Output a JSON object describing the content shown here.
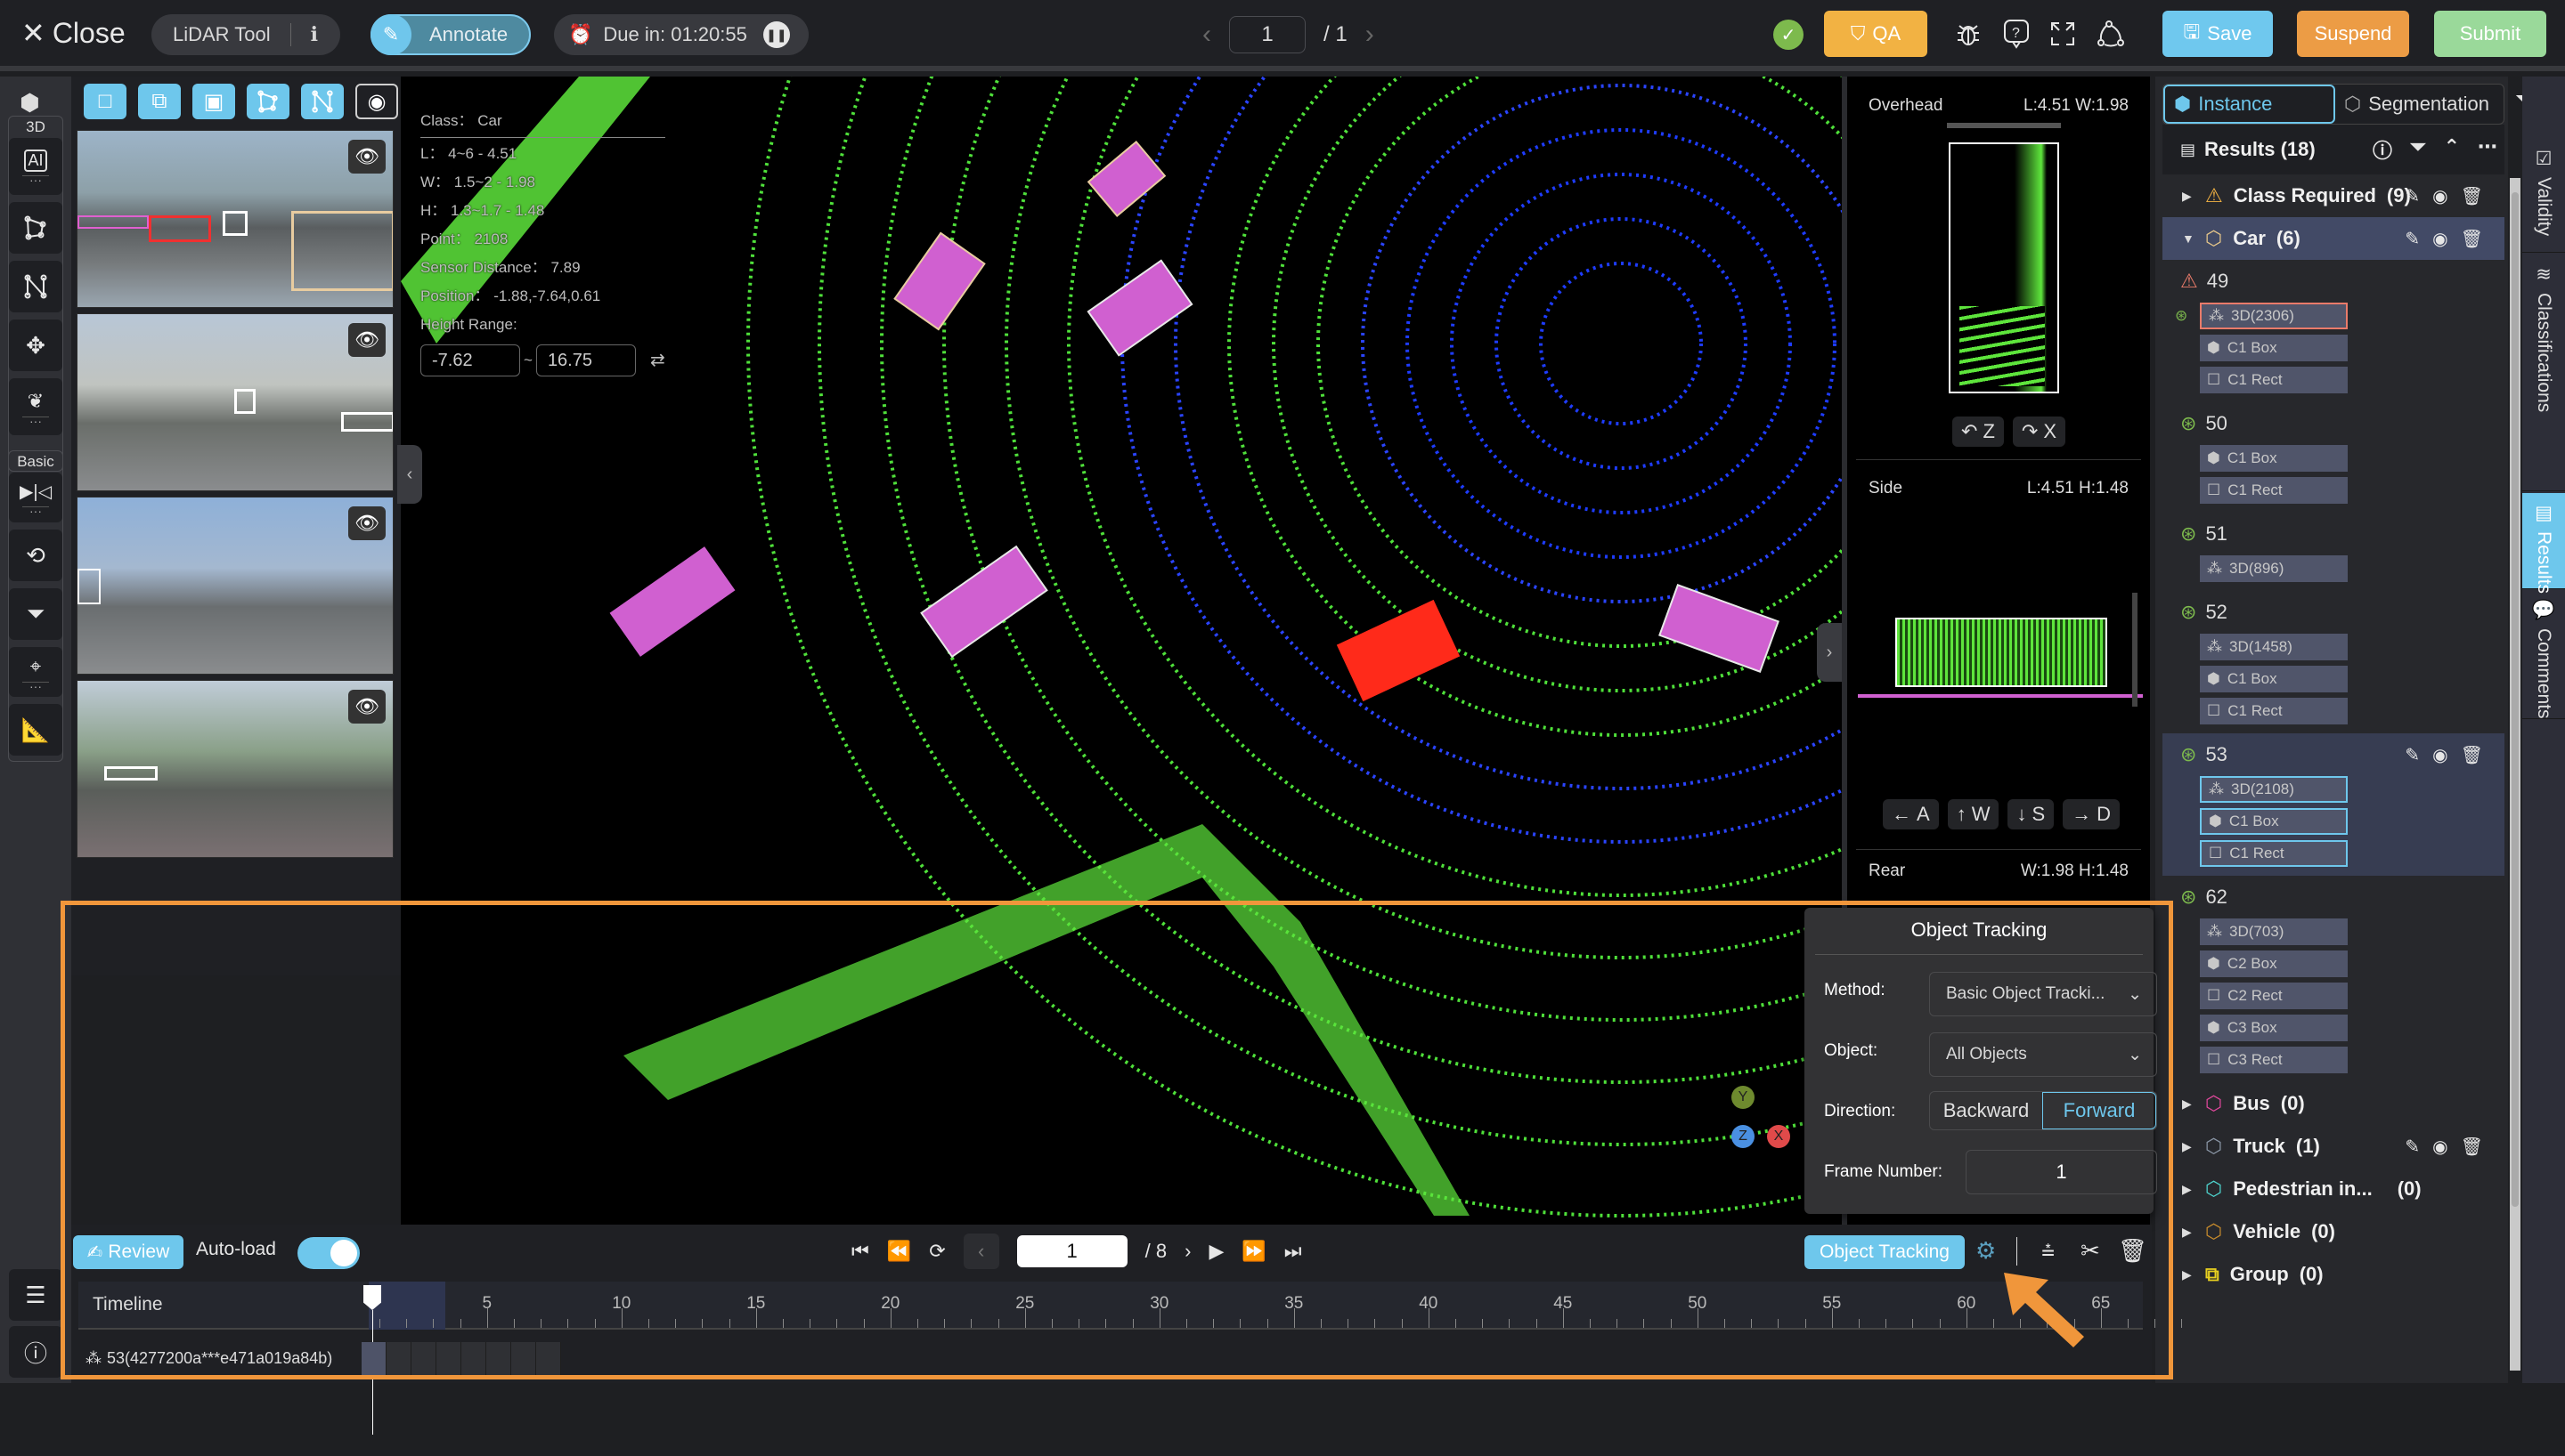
{
  "header": {
    "close_label": "Close",
    "tool_name": "LiDAR Tool",
    "mode_label": "Annotate",
    "due_label": "Due in: 01:20:55",
    "page_current": "1",
    "page_total": "/ 1",
    "qa_label": "QA",
    "save_label": "Save",
    "suspend_label": "Suspend",
    "submit_label": "Submit",
    "icons": [
      "bug-icon",
      "help-icon",
      "fullscreen-icon",
      "workflow-icon"
    ]
  },
  "left_rail": {
    "group_3d_label": "3D",
    "group_basic_label": "Basic"
  },
  "info_overlay": {
    "class_line": "Class：  Car",
    "l_line": "L：  4~6 - 4.51",
    "w_line": "W：  1.5~2 - 1.98",
    "h_line": "H：  1.3~1.7 - 1.48",
    "point_line": "Point：  2108",
    "sensor_line": "Sensor Distance：  7.89",
    "position_line": "Position：  -1.88,-7.64,0.61",
    "height_range_label": "Height Range:",
    "height_min": "-7.62",
    "height_max": "16.75"
  },
  "projections": {
    "overhead": {
      "label": "Overhead",
      "dims": "L:4.51 W:1.98"
    },
    "side": {
      "label": "Side",
      "dims": "L:4.51 H:1.48"
    },
    "rear": {
      "label": "Rear",
      "dims": "W:1.98 H:1.48"
    },
    "rotate_z": "Z",
    "rotate_x": "X",
    "move_keys": [
      "A",
      "W",
      "S",
      "D"
    ]
  },
  "axes": {
    "y": "Y",
    "z": "Z",
    "x": "X"
  },
  "right_panel": {
    "tab_instance": "Instance",
    "tab_segmentation": "Segmentation",
    "results_title": "Results (18)",
    "classes": [
      {
        "name": "Class Required",
        "count": "(9)",
        "color": "#f2b243",
        "expanded": false
      },
      {
        "name": "Car",
        "count": "(6)",
        "color": "#e8c88a",
        "expanded": true
      },
      {
        "name": "Bus",
        "count": "(0)",
        "color": "#e0489c"
      },
      {
        "name": "Truck",
        "count": "(1)",
        "color": "#8a96a6"
      },
      {
        "name": "Pedestrian in...",
        "count": "(0)",
        "color": "#4ed6d0"
      },
      {
        "name": "Vehicle",
        "count": "(0)",
        "color": "#c88c2c"
      },
      {
        "name": "Group",
        "count": "(0)",
        "color": "#e8d020"
      }
    ],
    "instances": [
      {
        "id": "49",
        "chips": [
          "3D(2306)",
          "C1 Box",
          "C1 Rect"
        ]
      },
      {
        "id": "50",
        "chips": [
          "C1 Box",
          "C1 Rect"
        ]
      },
      {
        "id": "51",
        "chips": [
          "3D(896)"
        ]
      },
      {
        "id": "52",
        "chips": [
          "3D(1458)",
          "C1 Box",
          "C1 Rect"
        ]
      },
      {
        "id": "53",
        "chips": [
          "3D(2108)",
          "C1 Box",
          "C1 Rect"
        ]
      },
      {
        "id": "62",
        "chips": [
          "3D(703)",
          "C2 Box",
          "C2 Rect",
          "C3 Box",
          "C3 Rect"
        ]
      }
    ]
  },
  "vertical_tabs": [
    "Validity",
    "Classifications",
    "Results",
    "Comments"
  ],
  "bottom": {
    "review_label": "Review",
    "autoload_label": "Auto-load",
    "autoload_on": true,
    "frame_current": "1",
    "frame_total": "/ 8",
    "object_tracking_label": "Object Tracking",
    "timeline_label": "Timeline",
    "tick_labels": [
      "5",
      "10",
      "15",
      "20",
      "25",
      "30",
      "35",
      "40",
      "45",
      "50",
      "55",
      "60",
      "65"
    ],
    "track_label": "53(4277200a***e471a019a84b)"
  },
  "tracking_popup": {
    "title": "Object Tracking",
    "method_label": "Method:",
    "method_value": "Basic Object Tracki...",
    "object_label": "Object:",
    "object_value": "All Objects",
    "direction_label": "Direction:",
    "direction_options": [
      "Backward",
      "Forward"
    ],
    "direction_selected": "Forward",
    "frame_label": "Frame Number:",
    "frame_value": "1"
  }
}
